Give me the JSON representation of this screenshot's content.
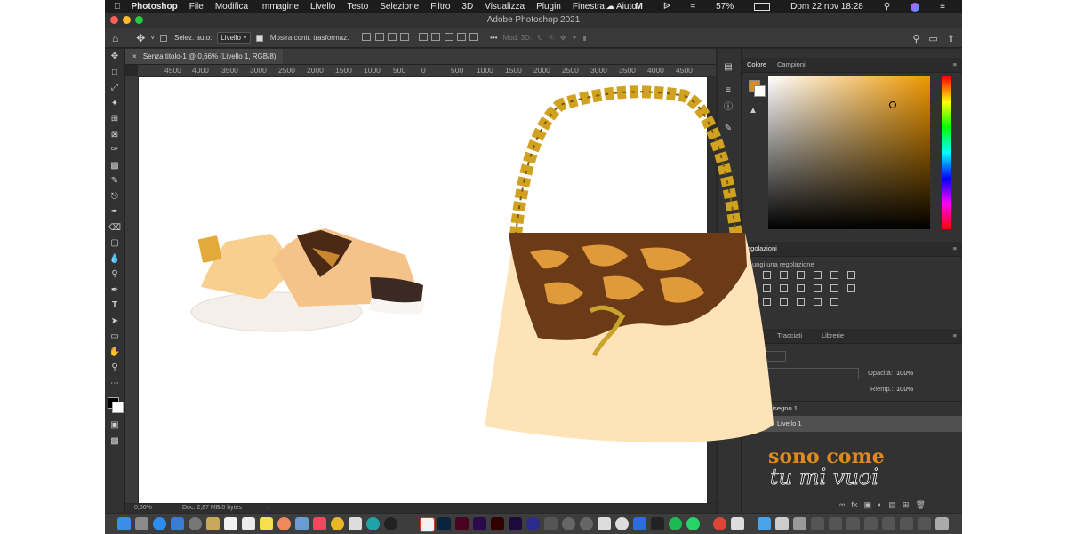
{
  "menubar": {
    "apple": "",
    "app_name": "Photoshop",
    "items": [
      "File",
      "Modifica",
      "Immagine",
      "Livello",
      "Testo",
      "Selezione",
      "Filtro",
      "3D",
      "Visualizza",
      "Plugin",
      "Finestra",
      "Aiuto"
    ],
    "battery": "57%",
    "datetime": "Dom 22 nov  18:28"
  },
  "window": {
    "title": "Adobe Photoshop 2021"
  },
  "options_bar": {
    "auto_select_label": "Selez. auto:",
    "auto_select_value": "Livello",
    "transform_controls_label": "Mostra contr. trasformaz.",
    "mode_3d_label": "Mod. 3D:"
  },
  "document": {
    "tab_title": "Senza titolo-1 @ 0,66% (Livello 1, RGB/8)",
    "ruler_ticks": [
      "4500",
      "4000",
      "3500",
      "3000",
      "2500",
      "2000",
      "1500",
      "1000",
      "500",
      "0",
      "500",
      "1000",
      "1500",
      "2000",
      "2500",
      "3000",
      "3500",
      "4000",
      "4500"
    ]
  },
  "status": {
    "zoom": "0,66%",
    "doc_info": "Doc: 2,87 MB/0 bytes"
  },
  "panels": {
    "color_tabs": [
      "Colore",
      "Campioni"
    ],
    "foreground_color": "#d88b24",
    "adjust_tab": "egolazioni",
    "adjust_hint": "ungi una regolazione",
    "layers_tabs": [
      "Canali",
      "Tracciati",
      "Librerie"
    ],
    "opacity_label": "Opacità:",
    "opacity_value": "100%",
    "fill_label": "Riemp.:",
    "fill_value": "100%",
    "artboard_name": "la da disegno 1",
    "layer_name": "Livello 1"
  },
  "watermark": {
    "line1": "sono come",
    "line2": "tu mi vuoi"
  }
}
